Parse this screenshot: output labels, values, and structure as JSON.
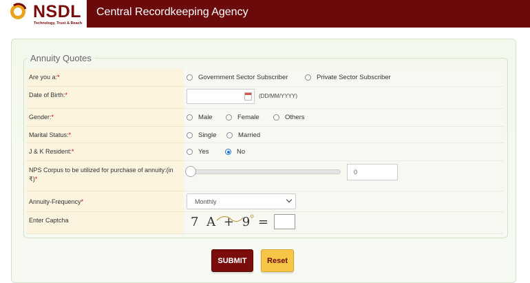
{
  "header": {
    "logo_text": "NSDL",
    "logo_tagline": "Technology, Trust & Reach",
    "app_title": "Central Recordkeeping Agency",
    "bar_color": "#6b0a0a"
  },
  "form": {
    "legend": "Annuity Quotes",
    "subscriber": {
      "label": "Are you a:",
      "options": [
        "Government Sector Subscriber",
        "Private Sector Subscriber"
      ]
    },
    "dob": {
      "label": "Date of Birth:",
      "value": "",
      "hint": "(DD/MM/YYYY)"
    },
    "gender": {
      "label": "Gender:",
      "options": [
        "Male",
        "Female",
        "Others"
      ]
    },
    "marital": {
      "label": "Marital Status:",
      "options": [
        "Single",
        "Married"
      ]
    },
    "jk": {
      "label": "J & K Resident:",
      "options": [
        "Yes",
        "No"
      ],
      "selected": "No"
    },
    "corpus": {
      "label": "NPS Corpus to be utilized for purchase of annuity:(in ₹)",
      "value": "0",
      "slider_fraction": 0
    },
    "frequency": {
      "label": "Annuity-Frequency",
      "selected": "Monthly"
    },
    "captcha": {
      "label": "Enter Captcha",
      "challenge": "7 A + 9  =",
      "value": ""
    },
    "required_mark": "*"
  },
  "buttons": {
    "submit": "SUBMIT",
    "reset": "Reset"
  }
}
